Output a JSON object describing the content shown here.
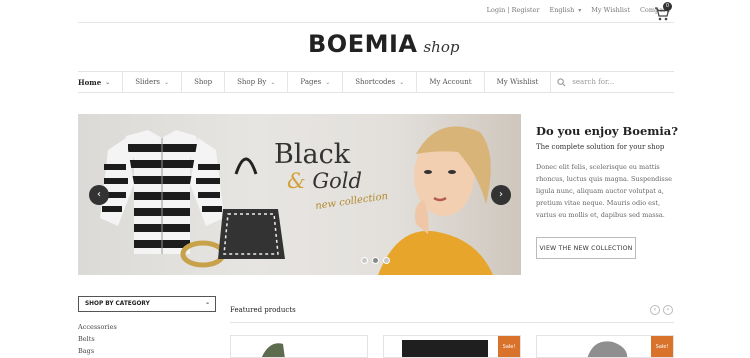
{
  "header": {
    "login_label": "Login | Register",
    "language_label": "English",
    "wishlist_label": "My Wishlist",
    "compare_label": "Compare",
    "cart_count": "0",
    "logo_main": "BOEMIA",
    "logo_sub": "shop"
  },
  "nav": {
    "items": [
      {
        "label": "Home",
        "dropdown": true
      },
      {
        "label": "Sliders",
        "dropdown": true
      },
      {
        "label": "Shop",
        "dropdown": false
      },
      {
        "label": "Shop By",
        "dropdown": true
      },
      {
        "label": "Pages",
        "dropdown": true
      },
      {
        "label": "Shortcodes",
        "dropdown": true
      },
      {
        "label": "My Account",
        "dropdown": false
      },
      {
        "label": "My Wishlist",
        "dropdown": false
      }
    ],
    "search_placeholder": "search for..."
  },
  "hero": {
    "title_line1": "Black",
    "title_amp": "&",
    "title_line2": "Gold",
    "subtitle": "new collection",
    "prev_label": "‹",
    "next_label": "›",
    "slide_count": 3,
    "active_slide": 1
  },
  "promo": {
    "title": "Do you enjoy Boemia?",
    "subtitle": "The complete solution for your shop",
    "text": "Donec elit felis, scelerisque eu mattis rhoncus, luctus quis magna. Suspendisse ligula nunc, aliquam auctor volutpat a, pretium vitae neque. Mauris odio est, varius eu mollis et, dapibus sed massa.",
    "button_label": "VIEW THE NEW COLLECTION"
  },
  "sidebar": {
    "category_title": "SHOP BY CATEGORY",
    "collapse_symbol": "–",
    "categories": [
      "Accessories",
      "Belts",
      "Bags"
    ]
  },
  "featured": {
    "title": "Featured products",
    "prev_label": "‹",
    "next_label": "›",
    "sale_label": "Sale!"
  },
  "colors": {
    "accent_gold": "#d2a13a",
    "sale_orange": "#d9722b",
    "dark": "#333333"
  }
}
